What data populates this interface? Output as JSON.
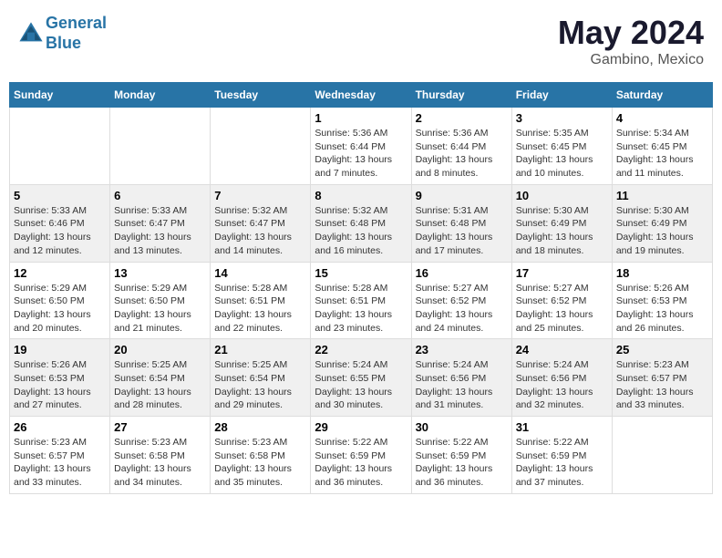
{
  "header": {
    "logo_line1": "General",
    "logo_line2": "Blue",
    "title": "May 2024",
    "subtitle": "Gambino, Mexico"
  },
  "weekdays": [
    "Sunday",
    "Monday",
    "Tuesday",
    "Wednesday",
    "Thursday",
    "Friday",
    "Saturday"
  ],
  "weeks": [
    {
      "days": [
        {
          "num": "",
          "info": ""
        },
        {
          "num": "",
          "info": ""
        },
        {
          "num": "",
          "info": ""
        },
        {
          "num": "1",
          "info": "Sunrise: 5:36 AM\nSunset: 6:44 PM\nDaylight: 13 hours and 7 minutes."
        },
        {
          "num": "2",
          "info": "Sunrise: 5:36 AM\nSunset: 6:44 PM\nDaylight: 13 hours and 8 minutes."
        },
        {
          "num": "3",
          "info": "Sunrise: 5:35 AM\nSunset: 6:45 PM\nDaylight: 13 hours and 10 minutes."
        },
        {
          "num": "4",
          "info": "Sunrise: 5:34 AM\nSunset: 6:45 PM\nDaylight: 13 hours and 11 minutes."
        }
      ]
    },
    {
      "days": [
        {
          "num": "5",
          "info": "Sunrise: 5:33 AM\nSunset: 6:46 PM\nDaylight: 13 hours and 12 minutes."
        },
        {
          "num": "6",
          "info": "Sunrise: 5:33 AM\nSunset: 6:47 PM\nDaylight: 13 hours and 13 minutes."
        },
        {
          "num": "7",
          "info": "Sunrise: 5:32 AM\nSunset: 6:47 PM\nDaylight: 13 hours and 14 minutes."
        },
        {
          "num": "8",
          "info": "Sunrise: 5:32 AM\nSunset: 6:48 PM\nDaylight: 13 hours and 16 minutes."
        },
        {
          "num": "9",
          "info": "Sunrise: 5:31 AM\nSunset: 6:48 PM\nDaylight: 13 hours and 17 minutes."
        },
        {
          "num": "10",
          "info": "Sunrise: 5:30 AM\nSunset: 6:49 PM\nDaylight: 13 hours and 18 minutes."
        },
        {
          "num": "11",
          "info": "Sunrise: 5:30 AM\nSunset: 6:49 PM\nDaylight: 13 hours and 19 minutes."
        }
      ]
    },
    {
      "days": [
        {
          "num": "12",
          "info": "Sunrise: 5:29 AM\nSunset: 6:50 PM\nDaylight: 13 hours and 20 minutes."
        },
        {
          "num": "13",
          "info": "Sunrise: 5:29 AM\nSunset: 6:50 PM\nDaylight: 13 hours and 21 minutes."
        },
        {
          "num": "14",
          "info": "Sunrise: 5:28 AM\nSunset: 6:51 PM\nDaylight: 13 hours and 22 minutes."
        },
        {
          "num": "15",
          "info": "Sunrise: 5:28 AM\nSunset: 6:51 PM\nDaylight: 13 hours and 23 minutes."
        },
        {
          "num": "16",
          "info": "Sunrise: 5:27 AM\nSunset: 6:52 PM\nDaylight: 13 hours and 24 minutes."
        },
        {
          "num": "17",
          "info": "Sunrise: 5:27 AM\nSunset: 6:52 PM\nDaylight: 13 hours and 25 minutes."
        },
        {
          "num": "18",
          "info": "Sunrise: 5:26 AM\nSunset: 6:53 PM\nDaylight: 13 hours and 26 minutes."
        }
      ]
    },
    {
      "days": [
        {
          "num": "19",
          "info": "Sunrise: 5:26 AM\nSunset: 6:53 PM\nDaylight: 13 hours and 27 minutes."
        },
        {
          "num": "20",
          "info": "Sunrise: 5:25 AM\nSunset: 6:54 PM\nDaylight: 13 hours and 28 minutes."
        },
        {
          "num": "21",
          "info": "Sunrise: 5:25 AM\nSunset: 6:54 PM\nDaylight: 13 hours and 29 minutes."
        },
        {
          "num": "22",
          "info": "Sunrise: 5:24 AM\nSunset: 6:55 PM\nDaylight: 13 hours and 30 minutes."
        },
        {
          "num": "23",
          "info": "Sunrise: 5:24 AM\nSunset: 6:56 PM\nDaylight: 13 hours and 31 minutes."
        },
        {
          "num": "24",
          "info": "Sunrise: 5:24 AM\nSunset: 6:56 PM\nDaylight: 13 hours and 32 minutes."
        },
        {
          "num": "25",
          "info": "Sunrise: 5:23 AM\nSunset: 6:57 PM\nDaylight: 13 hours and 33 minutes."
        }
      ]
    },
    {
      "days": [
        {
          "num": "26",
          "info": "Sunrise: 5:23 AM\nSunset: 6:57 PM\nDaylight: 13 hours and 33 minutes."
        },
        {
          "num": "27",
          "info": "Sunrise: 5:23 AM\nSunset: 6:58 PM\nDaylight: 13 hours and 34 minutes."
        },
        {
          "num": "28",
          "info": "Sunrise: 5:23 AM\nSunset: 6:58 PM\nDaylight: 13 hours and 35 minutes."
        },
        {
          "num": "29",
          "info": "Sunrise: 5:22 AM\nSunset: 6:59 PM\nDaylight: 13 hours and 36 minutes."
        },
        {
          "num": "30",
          "info": "Sunrise: 5:22 AM\nSunset: 6:59 PM\nDaylight: 13 hours and 36 minutes."
        },
        {
          "num": "31",
          "info": "Sunrise: 5:22 AM\nSunset: 6:59 PM\nDaylight: 13 hours and 37 minutes."
        },
        {
          "num": "",
          "info": ""
        }
      ]
    }
  ]
}
